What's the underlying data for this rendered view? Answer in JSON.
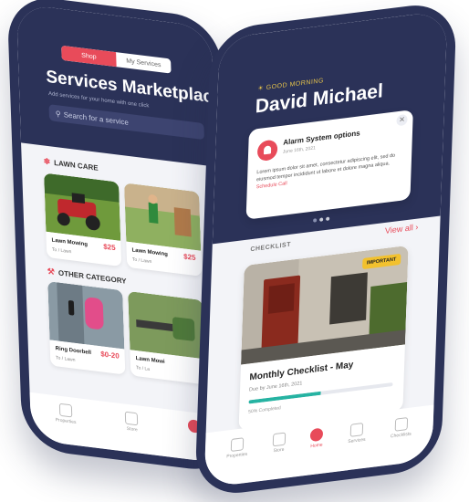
{
  "left_screen": {
    "segments": [
      {
        "label": "Shop",
        "active": true
      },
      {
        "label": "My Services",
        "active": false
      }
    ],
    "title": "Services Marketplace",
    "subtitle": "Add services for your home with one click",
    "search_placeholder": "Search for a service",
    "sections": [
      {
        "title": "LAWN CARE",
        "icon": "grass-icon",
        "cards": [
          {
            "name": "Lawn Mowing",
            "price": "$25",
            "meta": "To / Lawn"
          },
          {
            "name": "Lawn Mowing",
            "price": "$25",
            "meta": "To / Lawn"
          }
        ]
      },
      {
        "title": "OTHER CATEGORY",
        "icon": "tools-icon",
        "cards": [
          {
            "name": "Ring Doorbell",
            "price": "$0-20",
            "meta": "To / Lawn"
          },
          {
            "name": "Lawn Mowi",
            "price": "",
            "meta": "To / La"
          }
        ]
      }
    ],
    "nav": [
      {
        "label": "Properties",
        "icon": "home-icon",
        "active": false
      },
      {
        "label": "Store",
        "icon": "store-icon",
        "active": false
      },
      {
        "label": "",
        "icon": "home-active-icon",
        "active": true
      }
    ]
  },
  "right_screen": {
    "greeting": "GOOD MORNING",
    "name": "David Michael",
    "alert": {
      "title": "Alarm System options",
      "date": "June 16th, 2021",
      "body": "Lorem ipsum dolor sit amet, consectetur adipiscing elit, sed do eiusmod tempor incididunt ut labore et dolore magna aliqua.",
      "link": "Schedule Call"
    },
    "checklist_header": "CHECKLIST",
    "view_all": "View all",
    "checklist_card": {
      "tag": "IMPORTANT",
      "title": "Monthly Checklist - May",
      "due": "Due by June 16th, 2021",
      "progress": 0.5,
      "progress_label": "50% Completed"
    },
    "nav": [
      {
        "label": "Properties",
        "icon": "building-icon",
        "active": false
      },
      {
        "label": "Store",
        "icon": "store-icon",
        "active": false
      },
      {
        "label": "Home",
        "icon": "home-icon",
        "active": true
      },
      {
        "label": "Services",
        "icon": "services-icon",
        "active": false
      },
      {
        "label": "Checklists",
        "icon": "checklist-icon",
        "active": false
      }
    ]
  },
  "colors": {
    "navy": "#2b3258",
    "accent": "#e84b5a",
    "greeting": "#e8c54a",
    "progress": "#26b3a2",
    "tag": "#f2c12e"
  }
}
